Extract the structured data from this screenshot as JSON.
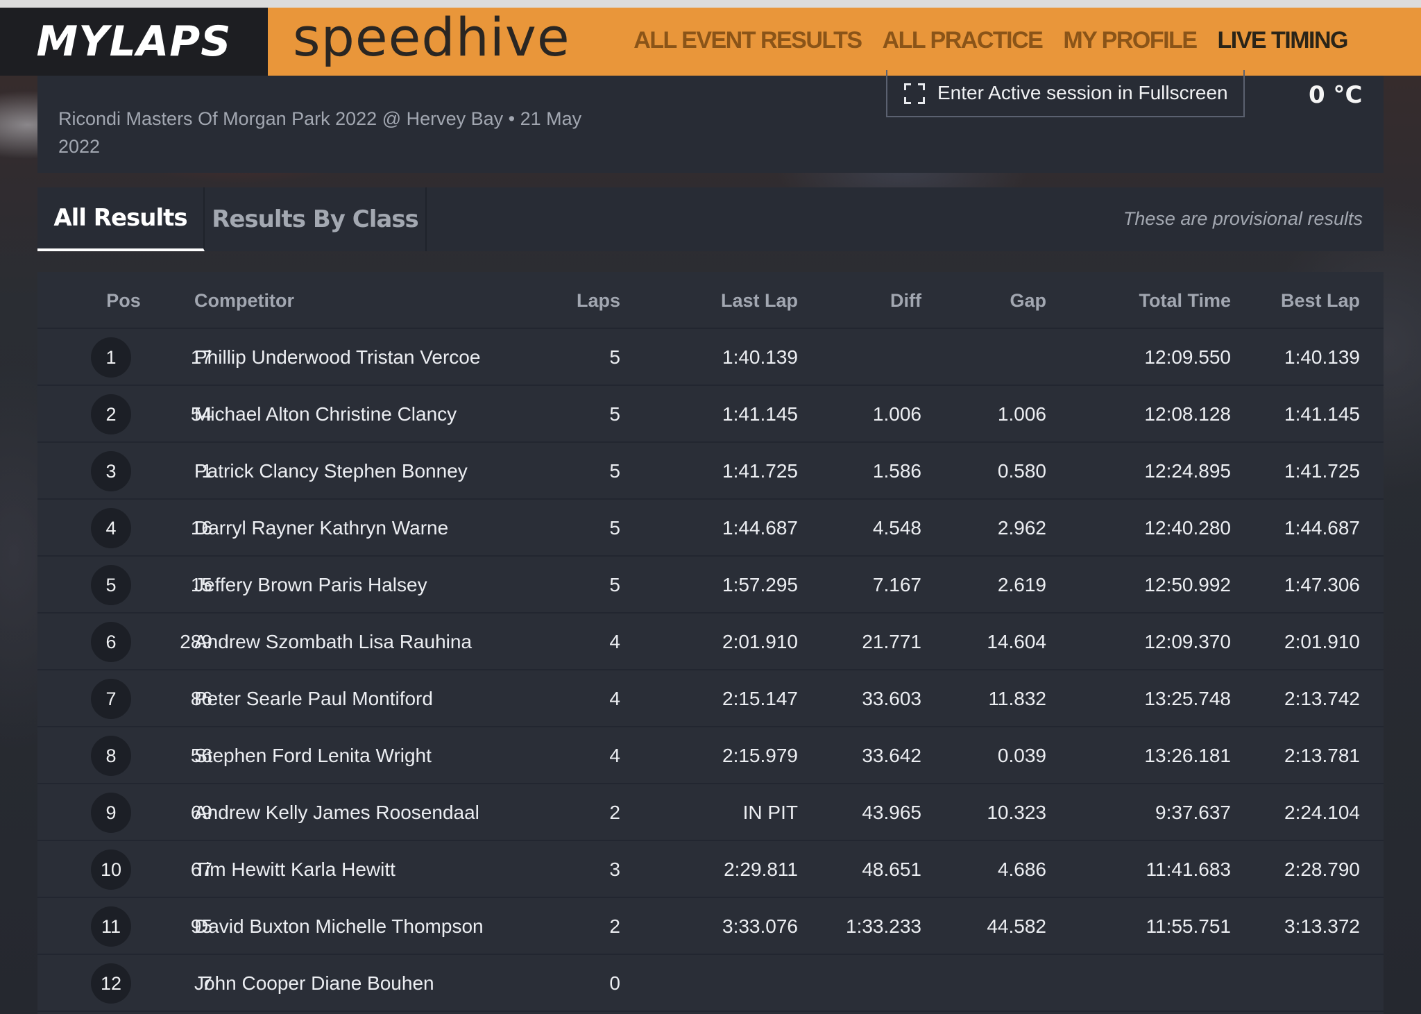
{
  "header": {
    "logo_text": "MYLAPS",
    "brand_text": "speedhive",
    "nav": [
      {
        "label": "ALL EVENT RESULTS",
        "active": false
      },
      {
        "label": "ALL PRACTICE",
        "active": false
      },
      {
        "label": "MY PROFILE",
        "active": false
      },
      {
        "label": "LIVE TIMING",
        "active": true
      }
    ]
  },
  "session": {
    "subtitle": "Ricondi Masters Of Morgan Park 2022 @ Hervey Bay • 21 May 2022",
    "fullscreen_label": "Enter Active session in Fullscreen",
    "temperature": "0 °C"
  },
  "tabs": {
    "items": [
      "All Results",
      "Results By Class"
    ],
    "active": "All Results",
    "provisional_note": "These are provisional results"
  },
  "table": {
    "columns": [
      "Pos",
      "Competitor",
      "Laps",
      "Last Lap",
      "Diff",
      "Gap",
      "Total Time",
      "Best Lap"
    ],
    "rows": [
      {
        "pos": "1",
        "num": "17",
        "name": "Phillip Underwood Tristan Vercoe",
        "laps": "5",
        "last": "1:40.139",
        "diff": "",
        "gap": "",
        "total": "12:09.550",
        "best": "1:40.139"
      },
      {
        "pos": "2",
        "num": "54",
        "name": "Michael Alton Christine Clancy",
        "laps": "5",
        "last": "1:41.145",
        "diff": "1.006",
        "gap": "1.006",
        "total": "12:08.128",
        "best": "1:41.145"
      },
      {
        "pos": "3",
        "num": "1",
        "name": "Patrick Clancy Stephen Bonney",
        "laps": "5",
        "last": "1:41.725",
        "diff": "1.586",
        "gap": "0.580",
        "total": "12:24.895",
        "best": "1:41.725"
      },
      {
        "pos": "4",
        "num": "16",
        "name": "Darryl Rayner Kathryn Warne",
        "laps": "5",
        "last": "1:44.687",
        "diff": "4.548",
        "gap": "2.962",
        "total": "12:40.280",
        "best": "1:44.687"
      },
      {
        "pos": "5",
        "num": "15",
        "name": "Jeffery Brown Paris Halsey",
        "laps": "5",
        "last": "1:57.295",
        "diff": "7.167",
        "gap": "2.619",
        "total": "12:50.992",
        "best": "1:47.306"
      },
      {
        "pos": "6",
        "num": "289",
        "name": "Andrew Szombath Lisa Rauhina",
        "laps": "4",
        "last": "2:01.910",
        "diff": "21.771",
        "gap": "14.604",
        "total": "12:09.370",
        "best": "2:01.910"
      },
      {
        "pos": "7",
        "num": "86",
        "name": "Peter Searle Paul Montiford",
        "laps": "4",
        "last": "2:15.147",
        "diff": "33.603",
        "gap": "11.832",
        "total": "13:25.748",
        "best": "2:13.742"
      },
      {
        "pos": "8",
        "num": "56",
        "name": "Stephen Ford Lenita Wright",
        "laps": "4",
        "last": "2:15.979",
        "diff": "33.642",
        "gap": "0.039",
        "total": "13:26.181",
        "best": "2:13.781"
      },
      {
        "pos": "9",
        "num": "69",
        "name": "Andrew Kelly James Roosendaal",
        "laps": "2",
        "last": "IN PIT",
        "diff": "43.965",
        "gap": "10.323",
        "total": "9:37.637",
        "best": "2:24.104"
      },
      {
        "pos": "10",
        "num": "67",
        "name": "Tim Hewitt Karla Hewitt",
        "laps": "3",
        "last": "2:29.811",
        "diff": "48.651",
        "gap": "4.686",
        "total": "11:41.683",
        "best": "2:28.790"
      },
      {
        "pos": "11",
        "num": "95",
        "name": "David Buxton Michelle Thompson",
        "laps": "2",
        "last": "3:33.076",
        "diff": "1:33.233",
        "gap": "44.582",
        "total": "11:55.751",
        "best": "3:13.372"
      },
      {
        "pos": "12",
        "num": "7",
        "name": "John Cooper Diane Bouhen",
        "laps": "0",
        "last": "",
        "diff": "",
        "gap": "",
        "total": "",
        "best": ""
      }
    ]
  }
}
